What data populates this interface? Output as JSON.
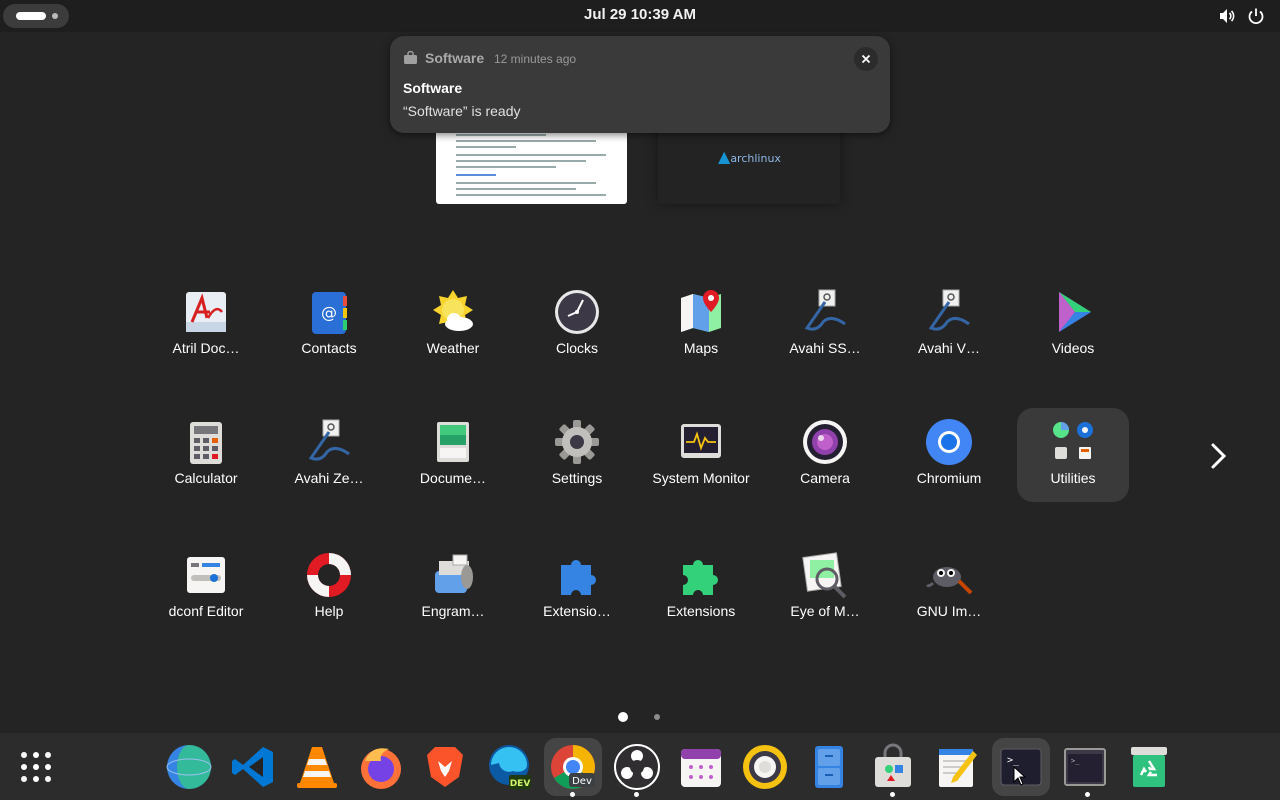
{
  "topbar": {
    "clock": "Jul 29  10:39 AM",
    "icons": [
      "volume-icon",
      "power-icon"
    ]
  },
  "notification": {
    "app_name": "Software",
    "time": "12 minutes ago",
    "title": "Software",
    "body": "“Software” is ready"
  },
  "workspaces": {
    "arch_label": "archlinux"
  },
  "apps": {
    "row1": [
      "Atril Doc…",
      "Contacts",
      "Weather",
      "Clocks",
      "Maps",
      "Avahi SS…",
      "Avahi V…",
      "Videos"
    ],
    "row2": [
      "Calculator",
      "Avahi Ze…",
      "Docume…",
      "Settings",
      "System Monitor",
      "Camera",
      "Chromium",
      "Utilities"
    ],
    "row3": [
      "dconf Editor",
      "Help",
      "Engram…",
      "Extensio…",
      "Extensions",
      "Eye of M…",
      "GNU Im…"
    ]
  },
  "pagination": {
    "current": 1,
    "total": 2
  },
  "dock": {
    "items": [
      "show-apps",
      "browser-globe",
      "vscode",
      "vlc",
      "firefox",
      "brave",
      "edge-dev",
      "chrome-dev",
      "obs",
      "calendar",
      "rhythmbox",
      "file-manager",
      "software",
      "text-editor",
      "terminal-dark",
      "terminal",
      "recycle"
    ],
    "chrome_badge": "Dev",
    "edge_badge": "DEV"
  },
  "colors": {
    "background": "#242424",
    "topbar": "#1e1e1e",
    "notification": "#3a3a3a",
    "dock": "#2c2c2c"
  }
}
